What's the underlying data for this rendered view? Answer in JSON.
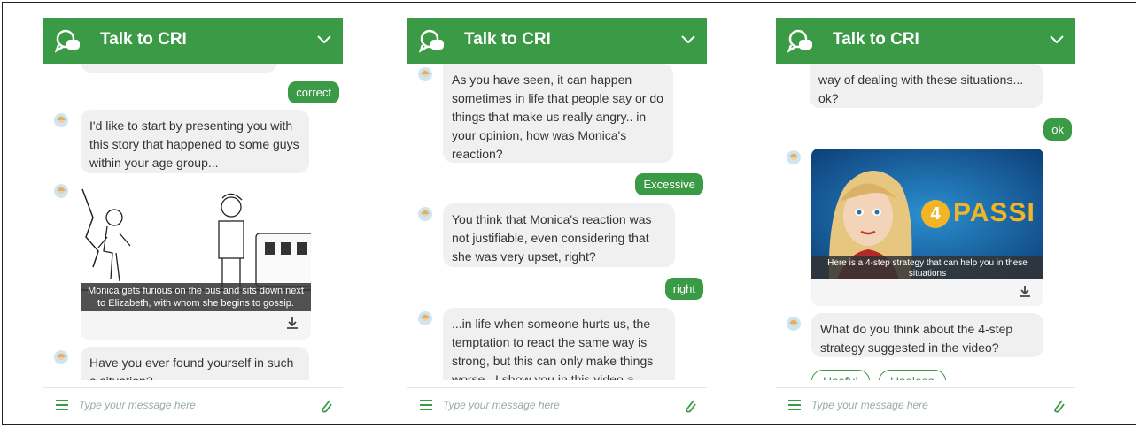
{
  "panels": [
    {
      "header": {
        "title": "Talk to CRI"
      },
      "input": {
        "placeholder": "Type your message here"
      },
      "messages": {
        "user_reply": "correct",
        "bot_msg_1": "I'd like to start by presenting you with this story that happened to some guys within your age group...",
        "video_caption": "Monica gets furious on the bus and sits down next to Elizabeth, with whom she begins to gossip.",
        "bot_msg_2": "Have you ever found yourself in such a situation?"
      }
    },
    {
      "header": {
        "title": "Talk to CRI"
      },
      "input": {
        "placeholder": "Type your message here"
      },
      "messages": {
        "bot_msg_1": "As you have seen, it can happen sometimes in life that people say or do things that make us really angry.. in your opinion, how was Monica's reaction?",
        "user_reply_1": "Excessive",
        "bot_msg_2": "You  think that Monica's reaction was not justifiable, even considering that she was very upset, right?",
        "user_reply_2": "right",
        "bot_msg_3": "...in life when someone hurts us, the temptation to react the same way is strong, but this can only make things worse...I show you in this video a better"
      }
    },
    {
      "header": {
        "title": "Talk to CRI"
      },
      "input": {
        "placeholder": "Type your message here"
      },
      "messages": {
        "bot_msg_1": "way of dealing with these situations... ok?",
        "user_reply": "ok",
        "video_badge_number": "4",
        "video_badge_text": "PASSI",
        "video_caption": "Here is a 4-step strategy that can help you in these situations",
        "bot_msg_2": "What do you think about the 4-step strategy suggested in the video?",
        "options": [
          "Useful",
          "Useless"
        ]
      }
    }
  ],
  "colors": {
    "accent": "#3a9a45",
    "bubble": "#f0f0f0",
    "text": "#333333"
  },
  "icons": [
    "chat-logo-icon",
    "chevron-down-icon",
    "avatar-icon",
    "download-icon",
    "menu-icon",
    "paperclip-icon"
  ]
}
